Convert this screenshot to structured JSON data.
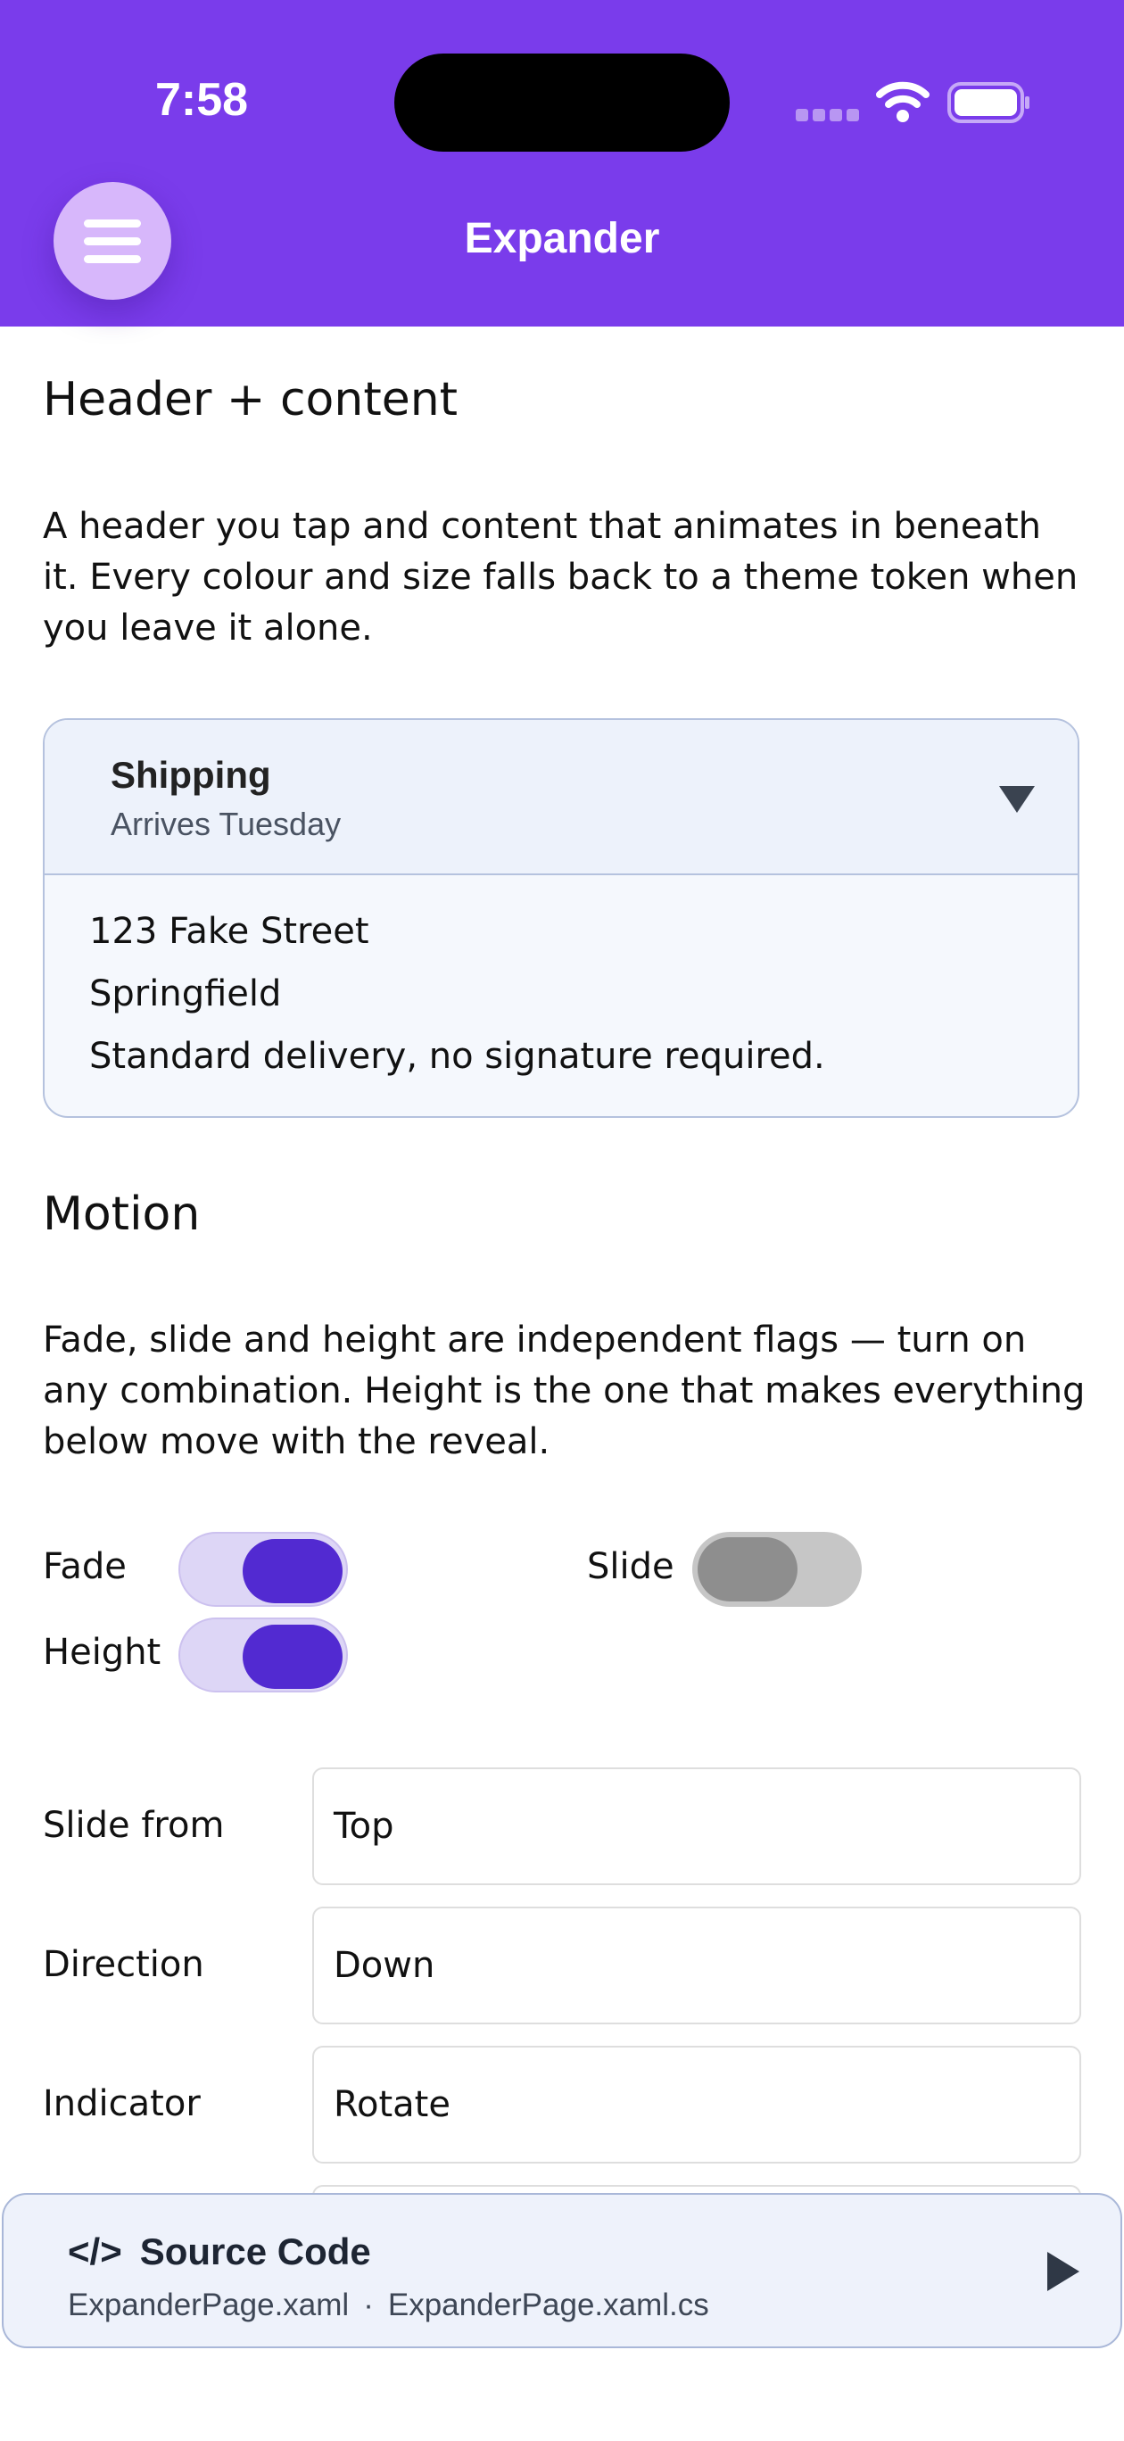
{
  "status": {
    "time": "7:58"
  },
  "header": {
    "title": "Expander"
  },
  "section1": {
    "heading": "Header + content",
    "description": "A header you tap and content that animates in beneath it. Every colour and size falls back to a theme token when you leave it alone."
  },
  "expander": {
    "title": "Shipping",
    "subtitle": "Arrives Tuesday",
    "lines": [
      "123 Fake Street",
      "Springfield",
      "Standard delivery, no signature required."
    ]
  },
  "section2": {
    "heading": "Motion",
    "description": "Fade, slide and height are independent flags — turn on any combination. Height is the one that makes everything below move with the reveal."
  },
  "toggles": {
    "fade": {
      "label": "Fade",
      "on": true
    },
    "slide": {
      "label": "Slide",
      "on": false
    },
    "height": {
      "label": "Height",
      "on": true
    }
  },
  "fields": {
    "slide_from": {
      "label": "Slide from",
      "value": "Top"
    },
    "direction": {
      "label": "Direction",
      "value": "Down"
    },
    "indicator": {
      "label": "Indicator",
      "value": "Rotate"
    }
  },
  "source": {
    "icon": "</>",
    "title": "Source Code",
    "file1": "ExpanderPage.xaml",
    "separator": "·",
    "file2": "ExpanderPage.xaml.cs"
  },
  "colors": {
    "topbar": "#7a3ceb",
    "accent": "#522ad1",
    "toggle_track_on": "#ddd6f6",
    "expander_border": "#b5c2de"
  },
  "icons": [
    "menu-icon",
    "wifi-icon",
    "battery-icon",
    "signal-icon",
    "chevron-down-icon",
    "play-icon"
  ]
}
